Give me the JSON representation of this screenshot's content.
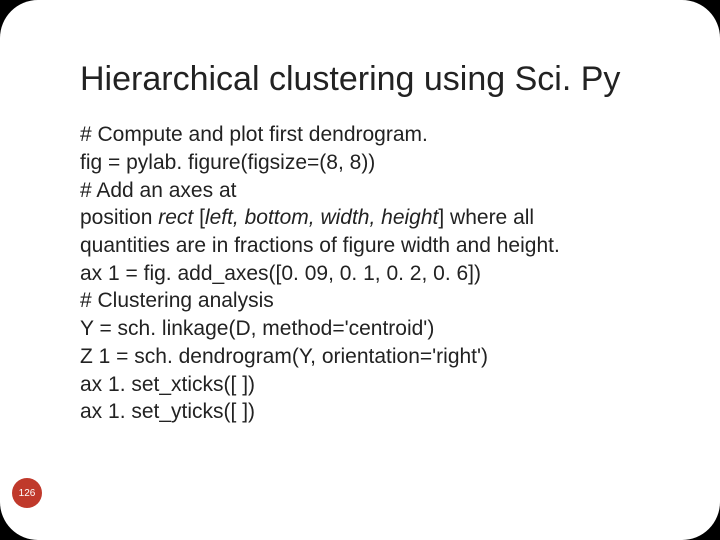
{
  "title": "Hierarchical clustering using Sci. Py",
  "lines": {
    "l0": "# Compute and plot first dendrogram.",
    "l1": "fig = pylab. figure(figsize=(8, 8))",
    "l2": "# Add an axes at",
    "l3_pre": "position ",
    "l3_it": "rect",
    "l3_mid": " [",
    "l3_it2": "left, bottom, width, height",
    "l3_post": "] where all",
    "l4": "quantities are in fractions of figure width and height.",
    "l5": "ax 1 = fig. add_axes([0. 09, 0. 1, 0. 2, 0. 6])",
    "l6": "# Clustering analysis",
    "l7": "Y = sch. linkage(D, method='centroid')",
    "l8": "Z 1 = sch. dendrogram(Y, orientation='right')",
    "l9": "ax 1. set_xticks([ ])",
    "l10": "ax 1. set_yticks([ ])"
  },
  "badge": "126"
}
